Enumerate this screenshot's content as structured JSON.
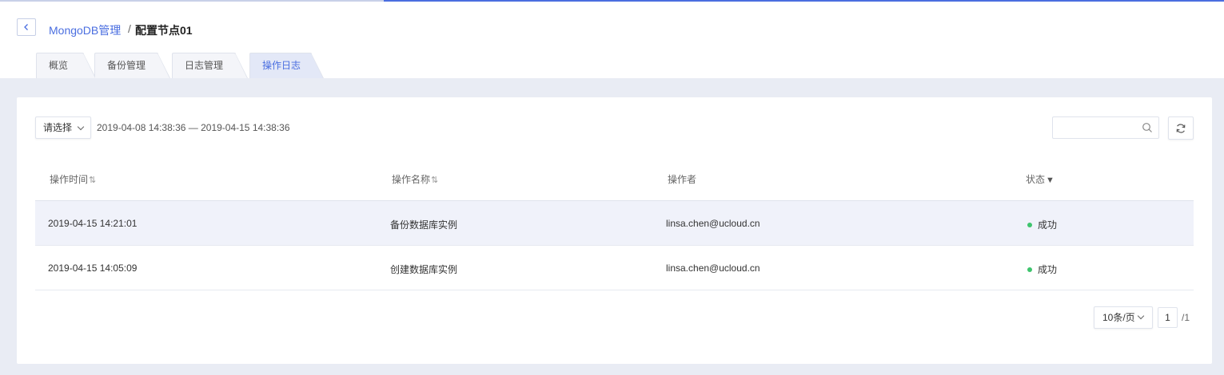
{
  "breadcrumb": {
    "parent": "MongoDB管理",
    "separator": "/",
    "current": "配置节点01"
  },
  "tabs": [
    {
      "label": "概览",
      "active": false
    },
    {
      "label": "备份管理",
      "active": false
    },
    {
      "label": "日志管理",
      "active": false
    },
    {
      "label": "操作日志",
      "active": true
    }
  ],
  "toolbar": {
    "select_label": "请选择",
    "date_range": "2019-04-08 14:38:36 — 2019-04-15 14:38:36",
    "search_value": ""
  },
  "table": {
    "columns": [
      "操作时间",
      "操作名称",
      "操作者",
      "状态"
    ],
    "sort_glyph": "⇅",
    "filter_glyph": "▼",
    "rows": [
      {
        "time": "2019-04-15 14:21:01",
        "name": "备份数据库实例",
        "operator": "linsa.chen@ucloud.cn",
        "status": "成功",
        "highlighted": true
      },
      {
        "time": "2019-04-15 14:05:09",
        "name": "创建数据库实例",
        "operator": "linsa.chen@ucloud.cn",
        "status": "成功",
        "highlighted": false
      }
    ]
  },
  "pagination": {
    "page_size": "10条/页",
    "current_page": "1",
    "total_pages": "/1"
  },
  "colors": {
    "accent": "#4a6ee0",
    "success": "#3ec46d",
    "background": "#e9ecf4"
  }
}
